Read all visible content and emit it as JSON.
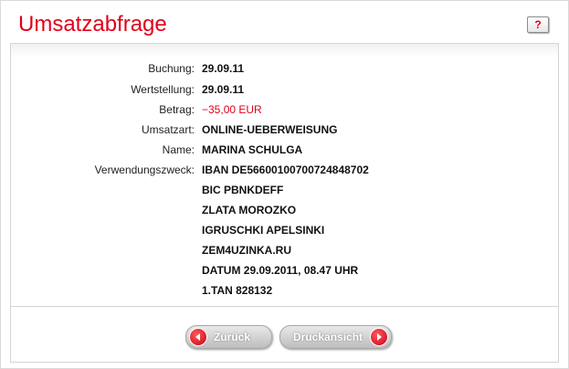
{
  "header": {
    "title": "Umsatzabfrage",
    "help_label": "?"
  },
  "details": {
    "buchung_label": "Buchung:",
    "buchung_value": "29.09.11",
    "wertstellung_label": "Wertstellung:",
    "wertstellung_value": "29.09.11",
    "betrag_label": "Betrag:",
    "betrag_value": "−35,00 EUR",
    "umsatzart_label": "Umsatzart:",
    "umsatzart_value": "ONLINE-UEBERWEISUNG",
    "name_label": "Name:",
    "name_value": "MARINA SCHULGA",
    "verwendungszweck_label": "Verwendungszweck:",
    "verwendungszweck_lines": [
      "IBAN DE56600100700724848702",
      "BIC PBNKDEFF",
      "ZLATA MOROZKO",
      "IGRUSCHKI APELSINKI",
      "ZEM4UZINKA.RU",
      "DATUM 29.09.2011, 08.47 UHR",
      "1.TAN 828132"
    ]
  },
  "buttons": {
    "back_label": "Zurück",
    "print_label": "Druckansicht"
  },
  "colors": {
    "accent": "#e2001a",
    "border": "#d4d4d4"
  }
}
